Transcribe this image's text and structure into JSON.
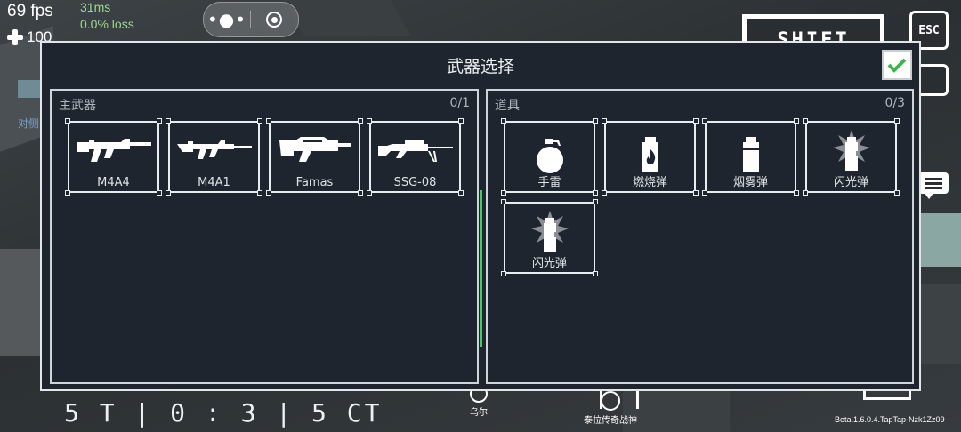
{
  "hud": {
    "fps": "69 fps",
    "ping": "31ms",
    "loss": "0.0% loss",
    "health": "100",
    "side_label": "对侧",
    "score": "5 T | 0 : 3 | 5 CT",
    "player_a": "乌尔",
    "player_b": "泰拉传奇战神",
    "version": "Beta.1.6.0.4.TapTap-Nzk1Zz09",
    "shift_label": "SHIFT",
    "esc_label": "ESC"
  },
  "dialog": {
    "title": "武器选择",
    "primary": {
      "header": "主武器",
      "count": "0/1",
      "items": [
        {
          "label": "M4A4",
          "icon": "m4a4-rifle-icon"
        },
        {
          "label": "M4A1",
          "icon": "m4a1-rifle-icon"
        },
        {
          "label": "Famas",
          "icon": "famas-rifle-icon"
        },
        {
          "label": "SSG-08",
          "icon": "sniper-rifle-icon"
        }
      ]
    },
    "equipment": {
      "header": "道具",
      "count": "0/3",
      "items": [
        {
          "label": "手雷",
          "icon": "frag-grenade-icon"
        },
        {
          "label": "燃烧弹",
          "icon": "incendiary-grenade-icon"
        },
        {
          "label": "烟雾弹",
          "icon": "smoke-grenade-icon"
        },
        {
          "label": "闪光弹",
          "icon": "flashbang-icon"
        },
        {
          "label": "闪光弹",
          "icon": "flashbang-icon"
        }
      ]
    }
  },
  "colors": {
    "dialog_bg": "#1f252e",
    "border": "#e2e6ea",
    "confirm_check": "#3cb54a",
    "scrollbar": "#3fcf5a",
    "ping_text": "#9dd88a"
  }
}
